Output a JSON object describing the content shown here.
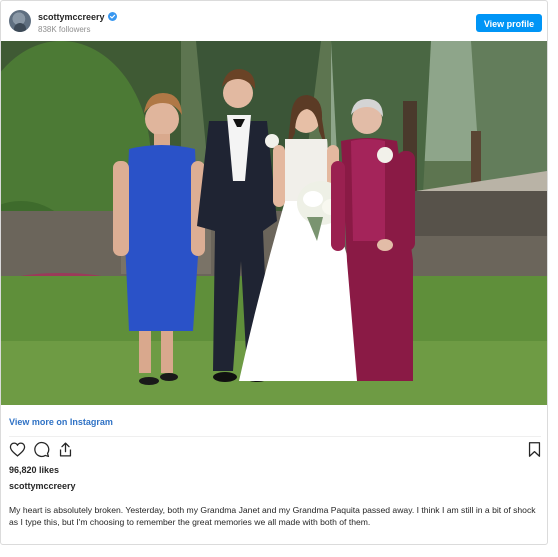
{
  "post": {
    "username": "scottymccreery",
    "followers": "838K followers",
    "view_profile_label": "View profile",
    "view_more_label": "View more on Instagram",
    "likes": "96,820 likes",
    "caption_username": "scottymccreery",
    "caption_text": "My heart is absolutely broken. Yesterday, both my Grandma Janet and my Grandma Paquita passed away. I think I am still in a bit of shock as I type this, but I'm choosing to remember the great memories we all made with both of them."
  },
  "icons": {
    "verified": "verified-badge-icon",
    "like": "heart-icon",
    "comment": "comment-icon",
    "share": "share-icon",
    "save": "bookmark-icon"
  },
  "colors": {
    "accent": "#0095f6",
    "link": "#2f72c5",
    "muted": "#8e8e8e"
  }
}
